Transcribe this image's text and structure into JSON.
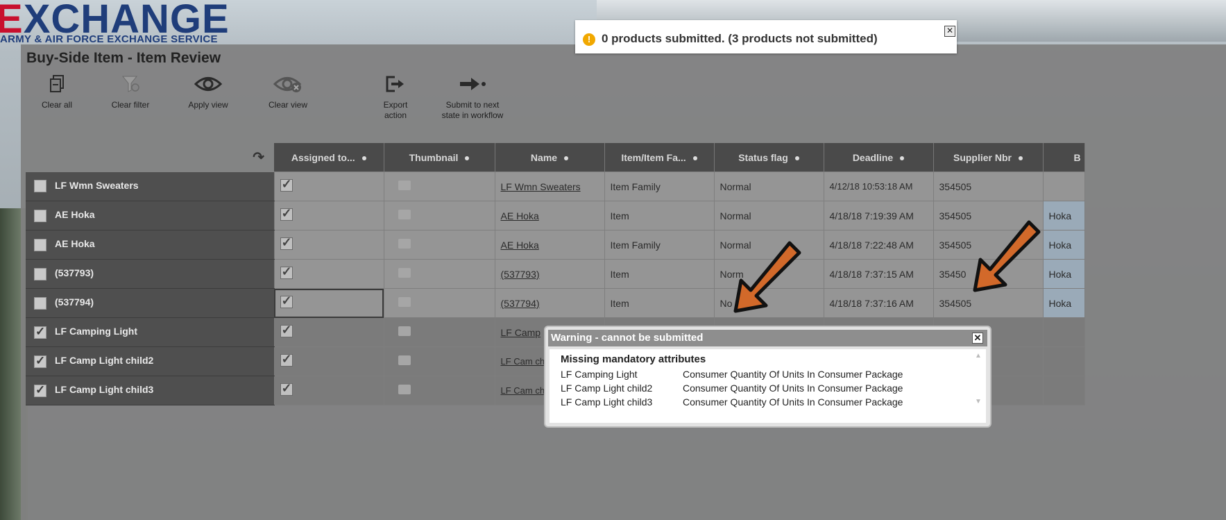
{
  "logo": {
    "main": "XCHANGE",
    "lead": "E",
    "tm": "™",
    "sub": "ARMY & AIR FORCE EXCHANGE SERVICE"
  },
  "page": {
    "title": "Buy-Side Item - Item Review"
  },
  "toolbar": {
    "clear_all": "Clear all",
    "clear_filter": "Clear filter",
    "apply_view": "Apply view",
    "clear_view": "Clear view",
    "export_action": "Export action",
    "submit": "Submit to next state in workflow"
  },
  "notification": {
    "text": "0 products submitted. (3 products not submitted)",
    "close": "✕"
  },
  "table": {
    "columns": [
      "Assigned to...",
      "Thumbnail",
      "Name",
      "Item/Item Fa...",
      "Status flag",
      "Deadline",
      "Supplier Nbr",
      "B"
    ],
    "rows": [
      {
        "label": "LF Wmn Sweaters",
        "name": "LF Wmn Sweaters",
        "type": "Item Family",
        "status": "Normal",
        "deadline": "4/12/18 10:53:18 AM",
        "supplier": "354505",
        "brand": ""
      },
      {
        "label": "AE Hoka",
        "name": "AE Hoka",
        "type": "Item",
        "status": "Normal",
        "deadline": "4/18/18 7:19:39 AM",
        "supplier": "354505",
        "brand": "Hoka"
      },
      {
        "label": "AE Hoka",
        "name": "AE Hoka",
        "type": "Item Family",
        "status": "Normal",
        "deadline": "4/18/18 7:22:48 AM",
        "supplier": "354505",
        "brand": "Hoka"
      },
      {
        "label": "(537793)",
        "name": "(537793)",
        "type": "Item",
        "status": "Norm",
        "deadline": "4/18/18 7:37:15 AM",
        "supplier": "35450",
        "brand": "Hoka"
      },
      {
        "label": "(537794)",
        "name": "(537794)",
        "type": "Item",
        "status": "No",
        "deadline": "4/18/18 7:37:16 AM",
        "supplier": "354505",
        "brand": "Hoka"
      },
      {
        "label": "LF Camping Light",
        "name": "LF Camp",
        "type": "",
        "status": "",
        "deadline": "",
        "supplier": "",
        "brand": ""
      },
      {
        "label": "LF Camp Light child2",
        "name": "LF Cam child2",
        "type": "",
        "status": "",
        "deadline": "",
        "supplier": "",
        "brand": ""
      },
      {
        "label": "LF Camp Light child3",
        "name": "LF Cam child3",
        "type": "",
        "status": "",
        "deadline": "",
        "supplier": "",
        "brand": ""
      }
    ]
  },
  "warning": {
    "title": "Warning - cannot be submitted",
    "close": "✕",
    "heading": "Missing mandatory attributes",
    "items": [
      {
        "name": "LF Camping Light",
        "attr": "Consumer Quantity Of Units In Consumer Package"
      },
      {
        "name": "LF Camp Light child2",
        "attr": "Consumer Quantity Of Units In Consumer Package"
      },
      {
        "name": "LF Camp Light child3",
        "attr": "Consumer Quantity Of Units In Consumer Package"
      }
    ]
  },
  "colors": {
    "arrow": "#d2692a",
    "header": "#4a4a4a",
    "notice_icon": "#f1a800"
  }
}
